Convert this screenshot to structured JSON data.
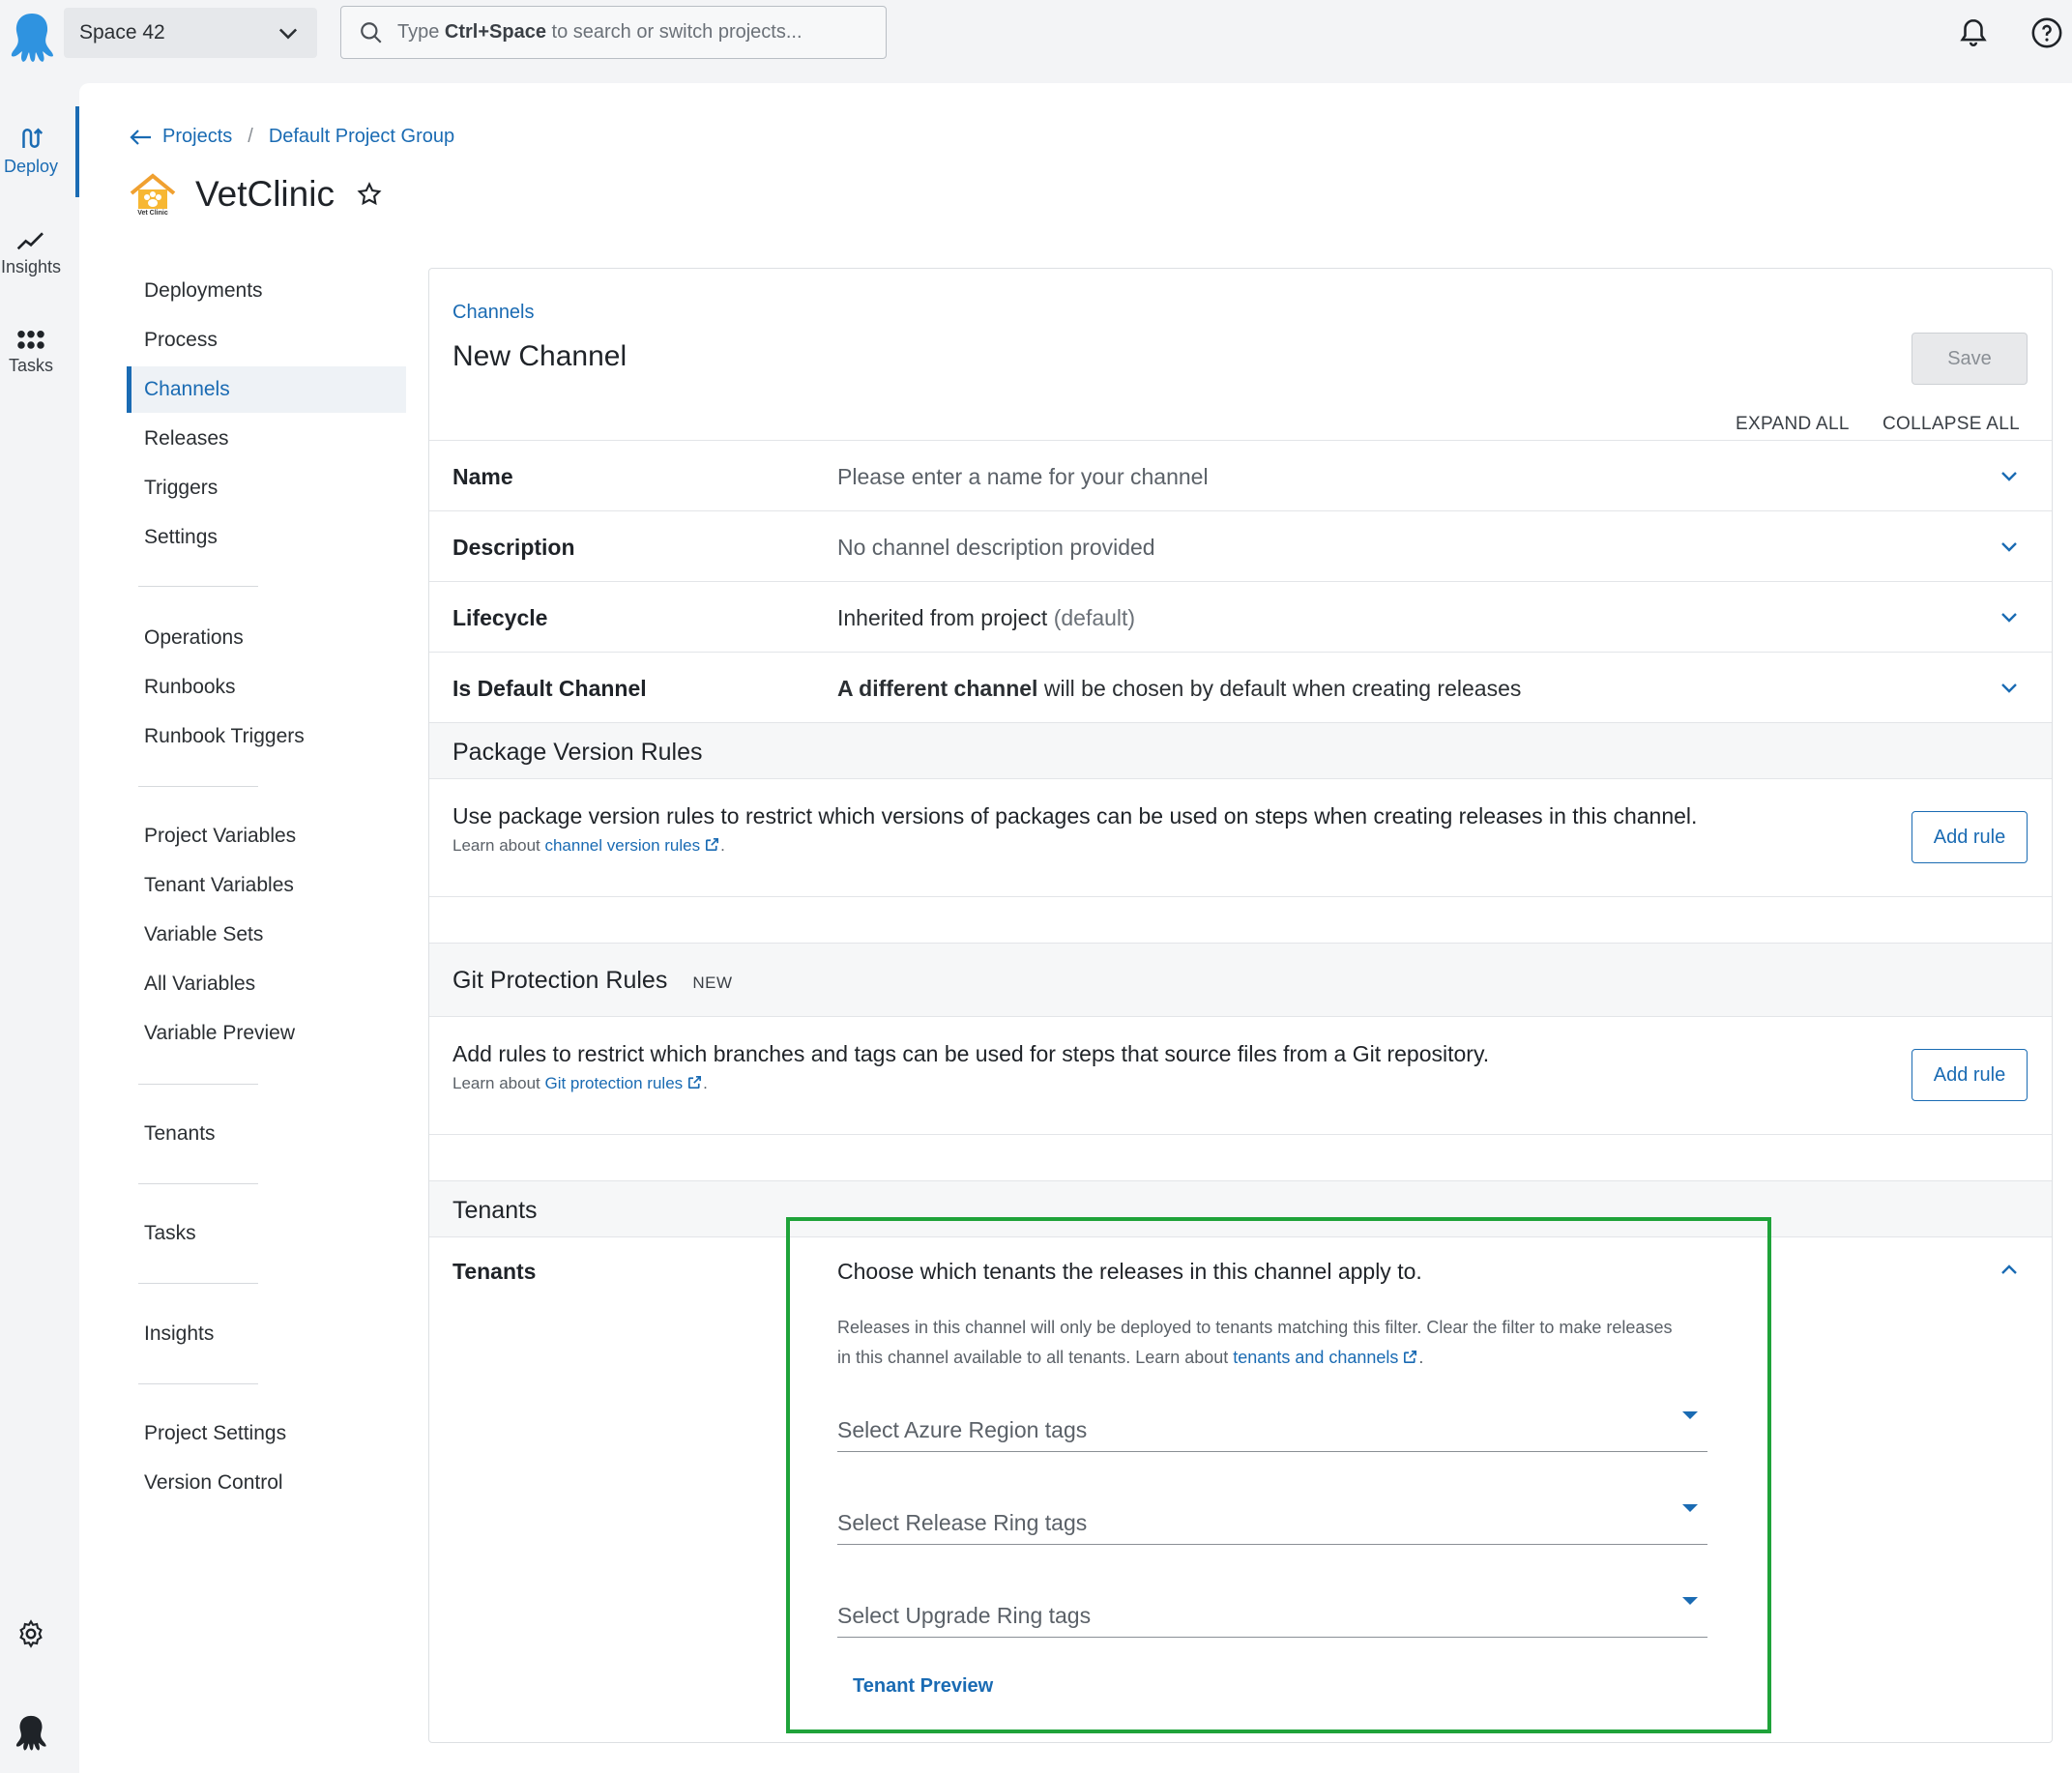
{
  "topbar": {
    "space_name": "Space 42",
    "search_prefix": "Type ",
    "search_shortcut": "Ctrl+Space",
    "search_suffix": " to search or switch projects..."
  },
  "rail": {
    "deploy": "Deploy",
    "insights": "Insights",
    "tasks": "Tasks"
  },
  "breadcrumb": {
    "projects": "Projects",
    "sep": "/",
    "group": "Default Project Group"
  },
  "project": {
    "name": "VetClinic",
    "logo_text": "Vet Clinic"
  },
  "nav": {
    "deployments": "Deployments",
    "process": "Process",
    "channels": "Channels",
    "releases": "Releases",
    "triggers": "Triggers",
    "settings": "Settings",
    "operations": "Operations",
    "runbooks": "Runbooks",
    "runbook_triggers": "Runbook Triggers",
    "project_variables": "Project Variables",
    "tenant_variables": "Tenant Variables",
    "variable_sets": "Variable Sets",
    "all_variables": "All Variables",
    "variable_preview": "Variable Preview",
    "tenants": "Tenants",
    "tasks": "Tasks",
    "insights": "Insights",
    "project_settings": "Project Settings",
    "version_control": "Version Control"
  },
  "page": {
    "crumb": "Channels",
    "title": "New Channel",
    "save": "Save",
    "expand_all": "EXPAND ALL",
    "collapse_all": "COLLAPSE ALL"
  },
  "fields": {
    "name_label": "Name",
    "name_value": "Please enter a name for your channel",
    "description_label": "Description",
    "description_value": "No channel description provided",
    "lifecycle_label": "Lifecycle",
    "lifecycle_value": "Inherited from project",
    "lifecycle_suffix": "(default)",
    "default_label": "Is Default Channel",
    "default_value_bold": "A different channel",
    "default_value_rest": " will be chosen by default when creating releases"
  },
  "package_rules": {
    "title": "Package Version Rules",
    "text": "Use package version rules to restrict which versions of packages can be used on steps when creating releases in this channel.",
    "learn_prefix": "Learn about ",
    "learn_link": "channel version rules",
    "learn_suffix": ".",
    "button": "Add rule"
  },
  "git_rules": {
    "title": "Git Protection Rules",
    "badge": "NEW",
    "text": "Add rules to restrict which branches and tags can be used for steps that source files from a Git repository.",
    "learn_prefix": "Learn about ",
    "learn_link": "Git protection rules",
    "learn_suffix": ".",
    "button": "Add rule"
  },
  "tenants": {
    "section_title": "Tenants",
    "label": "Tenants",
    "intro": "Choose which tenants the releases in this channel apply to.",
    "help": "Releases in this channel will only be deployed to tenants matching this filter. Clear the filter to make releases in this channel available to all tenants. Learn about ",
    "help_link": "tenants and channels",
    "help_suffix": ".",
    "azure_placeholder": "Select Azure Region tags",
    "release_placeholder": "Select Release Ring tags",
    "upgrade_placeholder": "Select Upgrade Ring tags",
    "preview": "Tenant Preview"
  },
  "colors": {
    "accent": "#1a6bb3",
    "highlight": "#1fa33a"
  }
}
